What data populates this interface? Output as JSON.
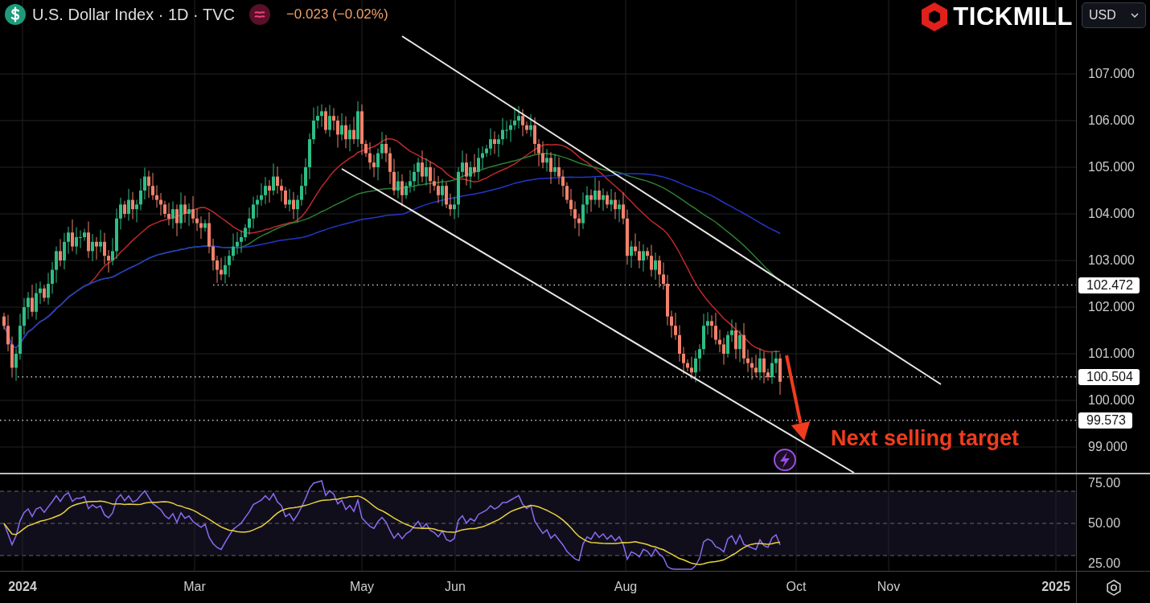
{
  "header": {
    "title": "U.S. Dollar Index · 1D · TVC",
    "change": "−0.023 (−0.02%)",
    "currency": "USD"
  },
  "logo": {
    "text": "TICKMILL"
  },
  "price_axis": [
    "107.000",
    "106.000",
    "105.000",
    "104.000",
    "103.000",
    "102.000",
    "101.000",
    "100.000",
    "99.000"
  ],
  "price_markers": [
    {
      "label": "102.472"
    },
    {
      "label": "100.504"
    },
    {
      "label": "99.573"
    }
  ],
  "annotation": "Next selling target",
  "rsi": {
    "axis": [
      "75.00",
      "50.00",
      "25.00"
    ]
  },
  "time_axis": [
    {
      "label": "2024",
      "kind": "year"
    },
    {
      "label": "Mar",
      "kind": "month"
    },
    {
      "label": "May",
      "kind": "month"
    },
    {
      "label": "Jun",
      "kind": "month"
    },
    {
      "label": "Aug",
      "kind": "month"
    },
    {
      "label": "Oct",
      "kind": "month"
    },
    {
      "label": "Nov",
      "kind": "month"
    },
    {
      "label": "2025",
      "kind": "year"
    }
  ]
}
